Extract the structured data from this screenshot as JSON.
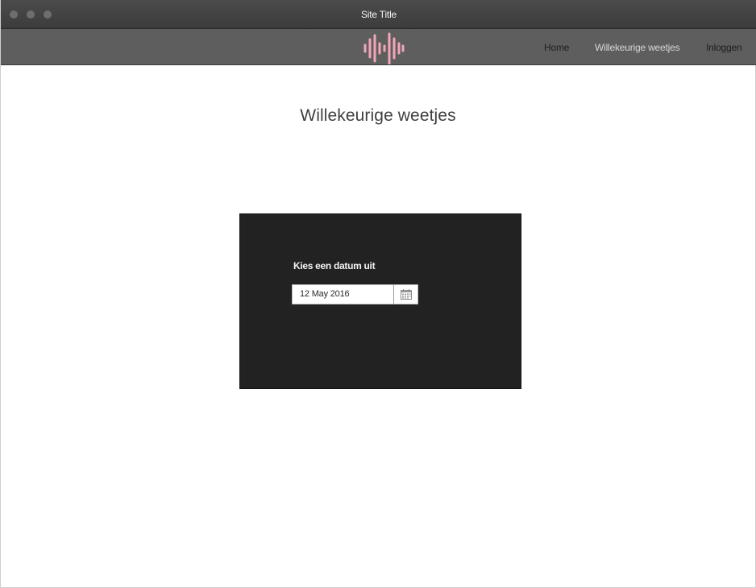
{
  "window": {
    "title": "Site Title"
  },
  "navbar": {
    "logo_icon": "soundwave-logo-icon",
    "logo_color": "#f4a6b8",
    "links": [
      {
        "label": "Home",
        "active": false
      },
      {
        "label": "Willekeurige weetjes",
        "active": true
      },
      {
        "label": "Inloggen",
        "active": false
      }
    ]
  },
  "main": {
    "heading": "Willekeurige weetjes",
    "panel": {
      "label": "Kies een datum uit",
      "date_value": "12 May 2016",
      "calendar_icon": "calendar-icon"
    }
  }
}
